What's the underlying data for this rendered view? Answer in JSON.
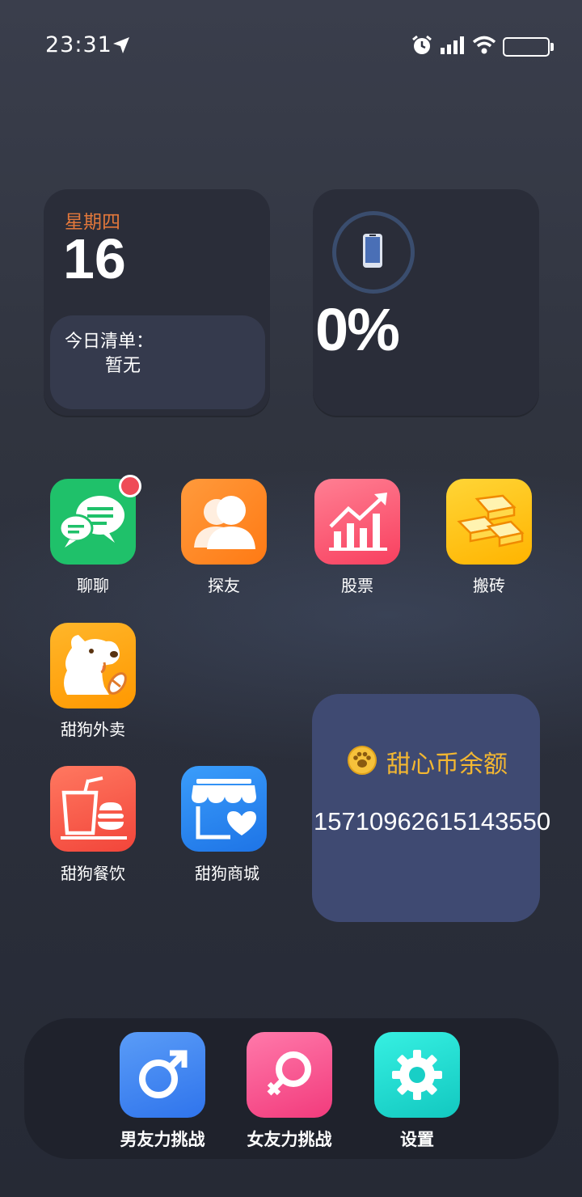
{
  "status_bar": {
    "time": "23:31",
    "icons": [
      "location-arrow-icon",
      "alarm-icon",
      "signal-icon",
      "wifi-icon",
      "battery-icon"
    ]
  },
  "date_widget": {
    "weekday": "星期四",
    "day": "16",
    "todo_title": "今日清单：",
    "todo_value": "暂无"
  },
  "battery_widget": {
    "percent": "0%",
    "icon": "phone-icon"
  },
  "apps": [
    {
      "label": "聊聊",
      "icon": "chat-bubbles-icon",
      "color": "#1fc16a",
      "has_badge": true
    },
    {
      "label": "探友",
      "icon": "people-icon",
      "color": "#ff8a24"
    },
    {
      "label": "股票",
      "icon": "stock-chart-icon",
      "color": "#fe5f7a"
    },
    {
      "label": "搬砖",
      "icon": "gold-bars-icon",
      "color": "#ffc414"
    },
    {
      "label": "甜狗外卖",
      "icon": "dog-icon",
      "color": "#ffa80f"
    },
    {
      "label": "甜狗餐饮",
      "icon": "drink-burger-icon",
      "color": "#ff5e4d"
    },
    {
      "label": "甜狗商城",
      "icon": "store-heart-icon",
      "color": "#2c8ef5"
    }
  ],
  "coin_widget": {
    "title": "甜心币余额",
    "amount": "15710962615143550",
    "icon": "paw-coin-icon"
  },
  "dock": [
    {
      "label": "男友力挑战",
      "icon": "male-symbol-icon",
      "color": "#3c87f2"
    },
    {
      "label": "女友力挑战",
      "icon": "female-symbol-icon",
      "color": "#ff4b8e"
    },
    {
      "label": "设置",
      "icon": "gear-icon",
      "color": "#1ee0d5"
    }
  ]
}
